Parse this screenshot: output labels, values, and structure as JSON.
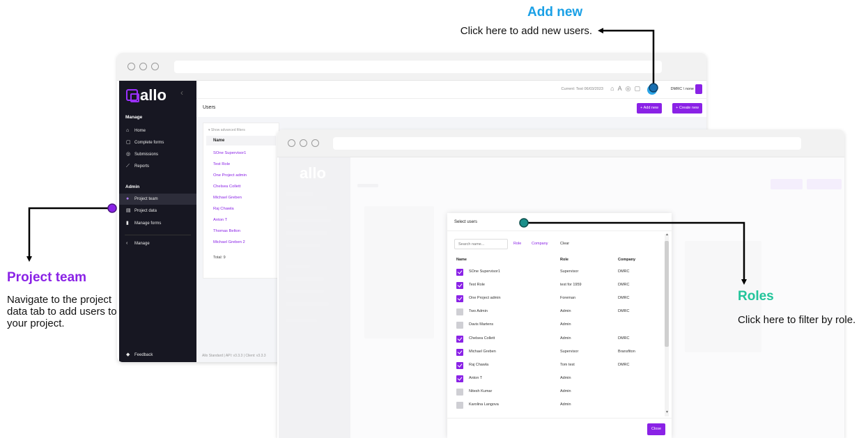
{
  "annotations": {
    "add_new": {
      "title": "Add new",
      "body": "Click here to add new users."
    },
    "project_team": {
      "title": "Project team",
      "body": "Navigate to the project data tab to add users to your project."
    },
    "roles": {
      "title": "Roles",
      "body": "Click here to filter by role."
    }
  },
  "colors": {
    "accent": "#8a22e6",
    "add_new": "#1aa0e6",
    "project_team": "#8a22e6",
    "roles": "#22c49a",
    "sidebar": "#171722"
  },
  "app": {
    "logo": "allo",
    "topbar": {
      "current": "Current: Test 06/03/2023",
      "user": "DMRC \\ none"
    },
    "sidebar": {
      "manage_heading": "Manage",
      "manage_items": [
        {
          "label": "Home",
          "icon": "home-icon",
          "glyph": "⌂"
        },
        {
          "label": "Complete forms",
          "icon": "clipboard-icon",
          "glyph": "▢"
        },
        {
          "label": "Submissions",
          "icon": "check-circle-icon",
          "glyph": "◎"
        },
        {
          "label": "Reports",
          "icon": "chart-icon",
          "glyph": "⟋"
        }
      ],
      "admin_heading": "Admin",
      "admin_items": [
        {
          "label": "Project team",
          "icon": "user-icon",
          "glyph": "●"
        },
        {
          "label": "Project data",
          "icon": "database-icon",
          "glyph": "▤"
        },
        {
          "label": "Manage forms",
          "icon": "document-icon",
          "glyph": "▮"
        }
      ],
      "collapse_item": {
        "label": "Manage",
        "glyph": "‹"
      },
      "feedback": {
        "label": "Feedback",
        "glyph": "◆"
      }
    },
    "users_page": {
      "title": "Users",
      "add_new_label": "Add new",
      "create_new_label": "Create new",
      "advanced_filters": "Show advanced filters",
      "name_header": "Name",
      "rows": [
        "SOne Supervisor1",
        "Test Role",
        "One Project admin",
        "Chelsea Collett",
        "Michael Greben",
        "Raj Chawla",
        "Anton T",
        "Thomas Belton",
        "Michael Greben 2"
      ],
      "total": "Total: 9",
      "footer": "Allo Standard | API: v3.3.3 | Client: v3.3.3"
    },
    "modal": {
      "title": "Select users",
      "search_placeholder": "Search name...",
      "filters": {
        "role": "Role",
        "company": "Company",
        "clear": "Clear"
      },
      "headers": {
        "name": "Name",
        "role": "Role",
        "company": "Company"
      },
      "rows": [
        {
          "name": "SOne Supervisor1",
          "role": "Supervisor",
          "company": "DMRC",
          "checked": true
        },
        {
          "name": "Test Role",
          "role": "test for 1959",
          "company": "DMRC",
          "checked": true
        },
        {
          "name": "One Project admin",
          "role": "Foreman",
          "company": "DMRC",
          "checked": true
        },
        {
          "name": "Two Admin",
          "role": "Admin",
          "company": "DMRC",
          "checked": false
        },
        {
          "name": "Davis Martens",
          "role": "Admin",
          "company": "",
          "checked": false
        },
        {
          "name": "Chelsea Collett",
          "role": "Admin",
          "company": "DMRC",
          "checked": true
        },
        {
          "name": "Michael Greben",
          "role": "Supervisor",
          "company": "Bransfiton",
          "checked": true
        },
        {
          "name": "Raj Chawla",
          "role": "Tom test",
          "company": "DMRC",
          "checked": true
        },
        {
          "name": "Anton T",
          "role": "Admin",
          "company": "",
          "checked": true
        },
        {
          "name": "Nitesh Kumar",
          "role": "Admin",
          "company": "",
          "checked": false
        },
        {
          "name": "Karolina Langova",
          "role": "Admin",
          "company": "",
          "checked": false
        }
      ],
      "close_label": "Close"
    }
  }
}
